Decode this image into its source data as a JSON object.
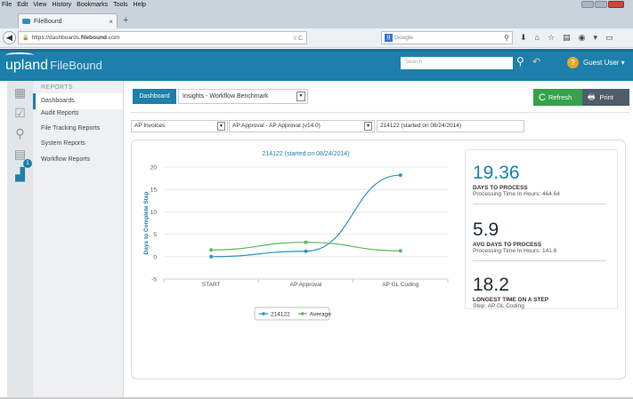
{
  "browser": {
    "menu": [
      "File",
      "Edit",
      "View",
      "History",
      "Bookmarks",
      "Tools",
      "Help"
    ],
    "tab_title": "FileBound",
    "tab_close": "×",
    "new_tab": "+",
    "url_prefix": "https://dashboards.",
    "url_domain": "filebound",
    "url_suffix": ".com",
    "search_placeholder": "Google"
  },
  "app": {
    "logo_main": "upland",
    "logo_sub": "FileBound",
    "search_placeholder": "Search",
    "user": "Guest User ▾",
    "help": "?"
  },
  "sidebar": {
    "section_title": "REPORTS",
    "badge": "1",
    "items": [
      {
        "label": "Dashboards"
      },
      {
        "label": "Audit Reports"
      },
      {
        "label": "File Tracking Reports"
      },
      {
        "label": "System Reports"
      },
      {
        "label": "Workflow Reports"
      }
    ]
  },
  "toolbar": {
    "dashboard_label": "Dashboard",
    "dashboard_select": "Insights - Workflow Benchmark",
    "refresh_label": "Refresh",
    "print_label": "Print"
  },
  "filters": {
    "project": "AP Invoices",
    "workflow": "AP Approval - AP Approval (v14.0)",
    "file": "214122 (started on 08/24/2014)"
  },
  "chart_data": {
    "type": "line",
    "title": "214122 (started on 08/24/2014)",
    "xlabel": "",
    "ylabel": "Days to Complete Step",
    "categories": [
      "START",
      "AP Approval",
      "AP GL Coding"
    ],
    "ylim": [
      -5,
      20
    ],
    "yticks": [
      -5,
      0,
      5,
      10,
      15,
      20
    ],
    "grid": true,
    "legend": "bottom",
    "series": [
      {
        "name": "214122",
        "values": [
          0,
          1.2,
          18.2
        ],
        "color": "#2a95c4"
      },
      {
        "name": "Average",
        "values": [
          1.5,
          3.2,
          1.3
        ],
        "color": "#5cb85c"
      }
    ]
  },
  "stats": [
    {
      "value": "19.36",
      "label": "DAYS TO PROCESS",
      "sub": "Processing Time In Hours: 464.64"
    },
    {
      "value": "5.9",
      "label": "AVG DAYS TO PROCESS",
      "sub": "Processing Time In Hours: 141.6"
    },
    {
      "value": "18.2",
      "label": "LONGEST TIME ON A STEP",
      "sub": "Step: AP GL Coding"
    }
  ],
  "colors": {
    "brand": "#1d7fab",
    "refresh": "#37a24a",
    "print": "#4e5d69"
  }
}
